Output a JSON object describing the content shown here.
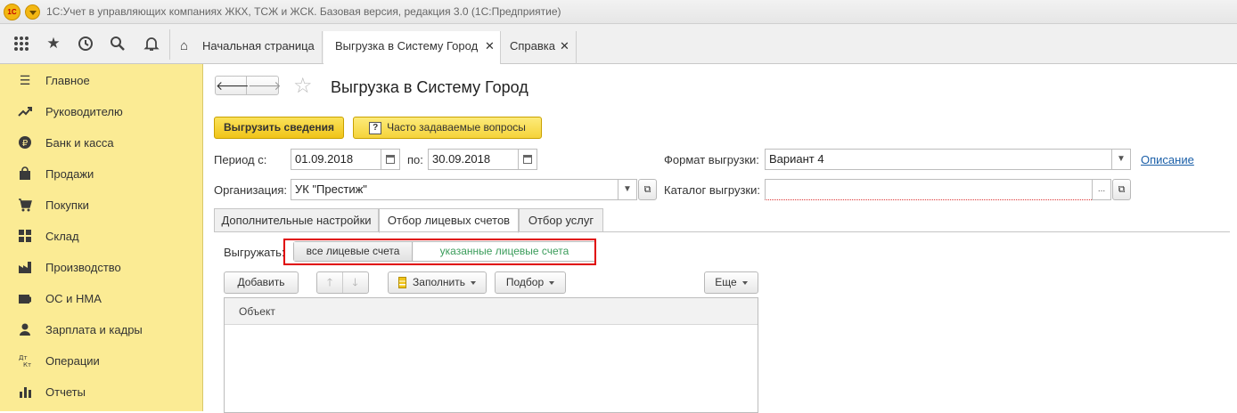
{
  "window": {
    "title": "1С:Учет в управляющих компаниях ЖКХ, ТСЖ и ЖСК. Базовая версия, редакция 3.0  (1С:Предприятие)",
    "logo_text": "1С"
  },
  "toolbar": {
    "icons": [
      "apps-grid-icon",
      "star-icon",
      "history-icon",
      "search-icon",
      "bell-icon"
    ]
  },
  "tabs": [
    {
      "label": "Начальная страница",
      "icon": "home-icon"
    },
    {
      "label": "Выгрузка в Систему Город",
      "active": true
    },
    {
      "label": "Справка"
    }
  ],
  "sidebar": {
    "items": [
      {
        "label": "Главное",
        "icon": "menu-lines-icon"
      },
      {
        "label": "Руководителю",
        "icon": "trend-up-icon"
      },
      {
        "label": "Банк и касса",
        "icon": "ruble-coin-icon"
      },
      {
        "label": "Продажи",
        "icon": "shopping-bag-icon"
      },
      {
        "label": "Покупки",
        "icon": "cart-icon"
      },
      {
        "label": "Склад",
        "icon": "warehouse-grid-icon"
      },
      {
        "label": "Производство",
        "icon": "factory-icon"
      },
      {
        "label": "ОС и НМА",
        "icon": "assets-icon"
      },
      {
        "label": "Зарплата и кадры",
        "icon": "person-icon"
      },
      {
        "label": "Операции",
        "icon": "dt-kt-icon"
      },
      {
        "label": "Отчеты",
        "icon": "bar-chart-icon"
      }
    ]
  },
  "form": {
    "title": "Выгрузка в Систему Город",
    "export_button": "Выгрузить сведения",
    "faq_button": "Часто задаваемые вопросы",
    "faq_icon_text": "?",
    "period_label": "Период с:",
    "period_from": "01.09.2018",
    "period_to_label": "по:",
    "period_to": "30.09.2018",
    "format_label": "Формат выгрузки:",
    "format_value": "Вариант 4",
    "description_link": "Описание",
    "org_label": "Организация:",
    "org_value": "УК \"Престиж\"",
    "catalog_label": "Каталог выгрузки:",
    "catalog_value": "",
    "catalog_dots": "...",
    "tabs": [
      {
        "label": "Дополнительные настройки"
      },
      {
        "label": "Отбор лицевых счетов",
        "active": true
      },
      {
        "label": "Отбор услуг"
      }
    ],
    "export_mode_label": "Выгружать:",
    "export_mode_options": [
      "все лицевые счета",
      "указанные лицевые счета"
    ],
    "export_mode_selected": "все лицевые счета",
    "add_button": "Добавить",
    "fill_button": "Заполнить",
    "pick_button": "Подбор",
    "more_button": "Еще",
    "table_header_object": "Объект"
  },
  "colors": {
    "sidebar_bg": "#fbeb94",
    "primary_button": "#f0c419",
    "accent_green": "#3a9c5a",
    "link_blue": "#1a5fa8",
    "highlight_red": "#e00000"
  }
}
